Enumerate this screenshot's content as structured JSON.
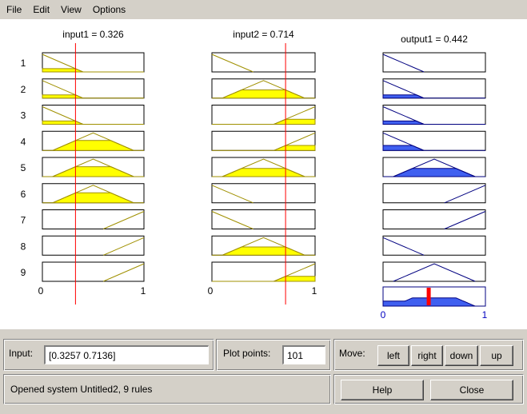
{
  "menu": [
    "File",
    "Edit",
    "View",
    "Options"
  ],
  "inputs": [
    {
      "name": "input1",
      "label": "input1 = 0.326",
      "value": 0.326,
      "tick_min": "0",
      "tick_max": "1"
    },
    {
      "name": "input2",
      "label": "input2 = 0.714",
      "value": 0.714,
      "tick_min": "0",
      "tick_max": "1"
    }
  ],
  "output": {
    "label": "output1 = 0.442",
    "value": 0.442,
    "tick_min": "0",
    "tick_max": "1"
  },
  "rules": [
    {
      "number": "1",
      "in1": "ramp_down",
      "in2": "ramp_down",
      "out": "ramp_down"
    },
    {
      "number": "2",
      "in1": "ramp_down",
      "in2": "triangle",
      "out": "ramp_down"
    },
    {
      "number": "3",
      "in1": "ramp_down",
      "in2": "ramp_up",
      "out": "ramp_down"
    },
    {
      "number": "4",
      "in1": "triangle",
      "in2": "ramp_up",
      "out": "ramp_down"
    },
    {
      "number": "5",
      "in1": "triangle",
      "in2": "triangle",
      "out": "triangle"
    },
    {
      "number": "6",
      "in1": "triangle",
      "in2": "ramp_down",
      "out": "ramp_up"
    },
    {
      "number": "7",
      "in1": "ramp_up",
      "in2": "ramp_down",
      "out": "ramp_up"
    },
    {
      "number": "8",
      "in1": "ramp_up",
      "in2": "triangle",
      "out": "ramp_down"
    },
    {
      "number": "9",
      "in1": "ramp_up",
      "in2": "ramp_up",
      "out": "triangle"
    }
  ],
  "colors": {
    "input_fill": "#ffff00",
    "input_line": "#a09000",
    "output_fill": "#4060f0",
    "output_line": "#000080",
    "axis_blue_text": "#0000c0",
    "marker_line": "#ff0000",
    "aggregate_marker": "#ff0000"
  },
  "controls": {
    "input_label": "Input:",
    "input_value": "[0.3257 0.7136]",
    "plot_points_label": "Plot points:",
    "plot_points_value": "101",
    "move_label": "Move:",
    "move_buttons": [
      "left",
      "right",
      "down",
      "up"
    ],
    "help_label": "Help",
    "close_label": "Close"
  },
  "status_text": "Opened system Untitled2, 9 rules"
}
